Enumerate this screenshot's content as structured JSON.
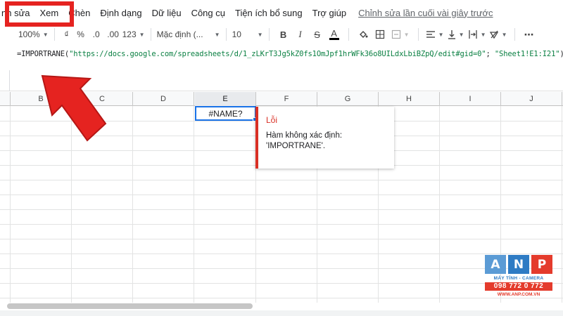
{
  "menubar": {
    "items": [
      "nh sửa",
      "Xem",
      "Chèn",
      "Định dạng",
      "Dữ liệu",
      "Công cụ",
      "Tiện ích bổ sung",
      "Trợ giúp"
    ],
    "last_edit": "Chỉnh sửa lần cuối vài giây trước"
  },
  "toolbar": {
    "zoom": "100%",
    "currency": "₫",
    "percent": "%",
    "decrease_decimal": ".0",
    "increase_decimal": ".00",
    "more_formats": "123",
    "font": "Mặc định (...",
    "font_size": "10",
    "bold": "B",
    "italic": "I",
    "strike": "S",
    "text_color": "A",
    "more": "⋯"
  },
  "formula": {
    "prefix": "=IMPORTRANE(",
    "url_string": "\"https://docs.google.com/spreadsheets/d/1_zLKrT3Jg5kZ0fs1OmJpf1hrWFk36o8UILdxLbiBZpQ/edit#gid=0\"",
    "separator": "; ",
    "range_string": "\"Sheet1!E1:I21\"",
    "suffix": ")"
  },
  "grid": {
    "columns": [
      "B",
      "C",
      "D",
      "E",
      "F",
      "G",
      "H",
      "I",
      "J"
    ],
    "active_column": "E",
    "active_cell_value": "#NAME?"
  },
  "error": {
    "title": "Lỗi",
    "message": "Hàm không xác định: 'IMPORTRANE'."
  },
  "watermark": {
    "letters": [
      "A",
      "N",
      "P"
    ],
    "tagline": "MÁY TÍNH - CAMERA",
    "phone": "098 772 0 772",
    "website": "WWW.ANP.COM.VN"
  },
  "colors": {
    "accent_red": "#e52320",
    "selection_blue": "#1a73e8",
    "error_red": "#d93025",
    "logo_blue": "#2e7bc4"
  }
}
